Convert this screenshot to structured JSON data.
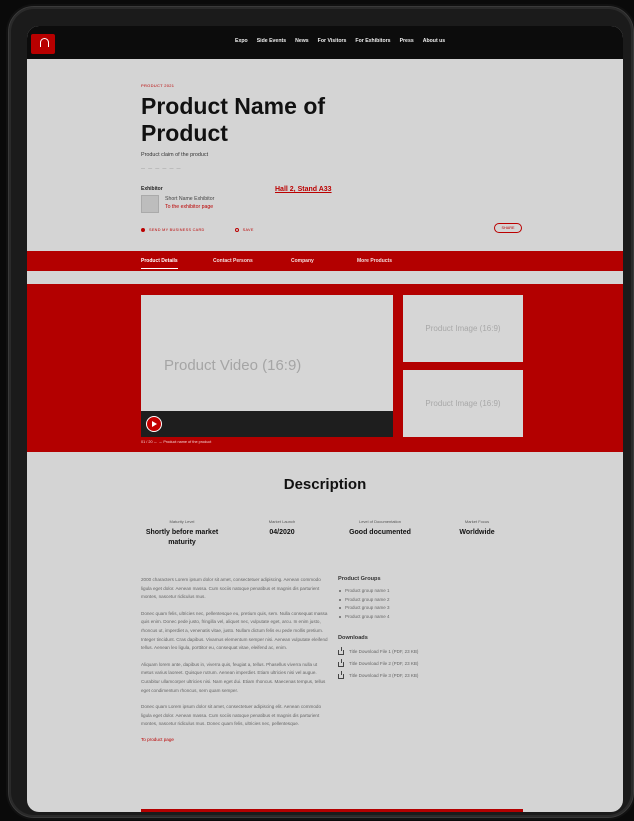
{
  "nav": {
    "items": [
      "Expo",
      "Side Events",
      "News",
      "For Visitors",
      "For Exhibitors",
      "Press",
      "About us"
    ]
  },
  "hero": {
    "eyebrow": "Product 2021",
    "title": "Product Name of Product",
    "claim": "Product claim of the product",
    "dashes": "— — — — — —"
  },
  "exhibitor": {
    "label": "Exhibitor",
    "name": "Short Name Exhibitor",
    "link": "To the exhibitor page",
    "hall": "Hall 2, Stand A33"
  },
  "actions": {
    "business_card": "Send my business card",
    "save": "Save",
    "share": "Share"
  },
  "tabs": [
    "Product Details",
    "Contact Persons",
    "Company",
    "More Products"
  ],
  "media": {
    "video_label": "Product Video (16:9)",
    "image_label_1": "Product Image (16:9)",
    "image_label_2": "Product Image (16:9)",
    "caption": "01 / 20    ←   →   Product name of the product"
  },
  "description": {
    "title": "Description",
    "stats": [
      {
        "label": "Maturity Level",
        "value": "Shortly before market maturity"
      },
      {
        "label": "Market Launch",
        "value": "04/2020"
      },
      {
        "label": "Level of Documentation",
        "value": "Good documented"
      },
      {
        "label": "Market Focus",
        "value": "Worldwide"
      }
    ],
    "paragraphs": [
      "2000 characters Lorem ipsum dolor sit amet, consectetuer adipiscing. Aenean commodo ligula eget dolor. Aenean massa. Cum sociis natoque penatibus et magnis dis parturient montes, nascetur ridiculus mus.",
      "Donec quam felis, ultricies nec, pellentesque eu, pretium quis, sem. Nulla consequat massa quis enim. Donec pede justo, fringilla vel, aliquet nec, vulputate eget, arcu. In enim justo, rhoncus ut, imperdiet a, venenatis vitae, justo. Nullam dictum felis eu pede mollis pretium. Integer tincidunt. Cras dapibus. Vivamus elementum semper nisi. Aenean vulputate eleifend tellus. Aenean leo ligula, porttitor eu, consequat vitae, eleifend ac, enim.",
      "Aliquam lorem ante, dapibus in, viverra quis, feugiat a, tellus. Phasellus viverra nulla ut metus varius laoreet. Quisque rutrum. Aenean imperdiet. Etiam ultricies nisi vel augue. Curabitur ullamcorper ultricies nisi. Nam eget dui. Etiam rhoncus. Maecenas tempus, tellus eget condimentum rhoncus, sem quam semper.",
      "Donec quam Lorem ipsum dolor sit amet, consectetuer adipiscing elit. Aenean commodo ligula eget dolor. Aenean massa. Cum sociis natoque penatibus et magnis dis parturient montes, nascetur ridiculus mus. Donec quam felis, ultricies nec, pellentesque."
    ],
    "link": "To product page"
  },
  "groups": {
    "heading": "Product Groups",
    "items": [
      "Product group name 1",
      "Product group name 2",
      "Product group name 3",
      "Product group name 4"
    ]
  },
  "downloads": {
    "heading": "Downloads",
    "items": [
      "Title Download File 1 (PDF, 23 KB)",
      "Title Download File 2 (PDF, 23 KB)",
      "Title Download File 3 (PDF, 23 KB)"
    ]
  },
  "colors": {
    "accent": "#b30000",
    "background": "#d4d4d4",
    "topbar": "#0c0c0c"
  }
}
